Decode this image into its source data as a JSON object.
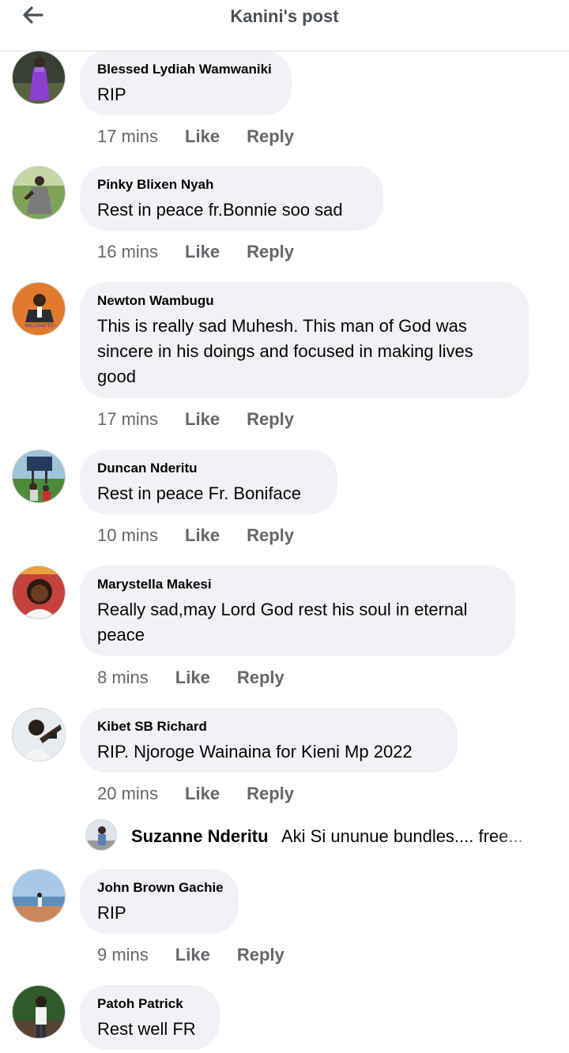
{
  "header": {
    "title": "Kanini's post",
    "back_icon": "arrow-left-icon"
  },
  "comments": [
    {
      "author": "Blessed Lydiah Wamwaniki",
      "text": "RIP",
      "time": "17 mins",
      "like": "Like",
      "reply": "Reply"
    },
    {
      "author": "Pinky Blixen Nyah",
      "text": "Rest in peace fr.Bonnie soo sad",
      "time": "16 mins",
      "like": "Like",
      "reply": "Reply"
    },
    {
      "author": "Newton Wambugu",
      "text": "This is really sad Muhesh. This man of God was sincere in his doings and focused in making lives good",
      "time": "17 mins",
      "like": "Like",
      "reply": "Reply"
    },
    {
      "author": "Duncan Nderitu",
      "text": "Rest in peace Fr. Boniface",
      "time": "10 mins",
      "like": "Like",
      "reply": "Reply"
    },
    {
      "author": "Marystella Makesi",
      "text": "Really sad,may Lord God rest his soul in eternal peace",
      "time": "8 mins",
      "like": "Like",
      "reply": "Reply"
    },
    {
      "author": "Kibet SB Richard",
      "text": "RIP. Njoroge Wainaina for Kieni Mp 2022",
      "time": "20 mins",
      "like": "Like",
      "reply": "Reply"
    },
    {
      "author": "John Brown Gachie",
      "text": "RIP",
      "time": "9 mins",
      "like": "Like",
      "reply": "Reply"
    },
    {
      "author": "Patoh Patrick",
      "text": "Rest well FR"
    }
  ],
  "reply_preview": {
    "author": "Suzanne Nderitu",
    "text": "Aki Si ununue bundles.... free..."
  },
  "avatar_text": {
    "newton": "VACCINATED"
  },
  "colors": {
    "bubble": "#f0f2f5",
    "meta": "#65676b",
    "text": "#050505",
    "header_title": "#4b4f56"
  }
}
